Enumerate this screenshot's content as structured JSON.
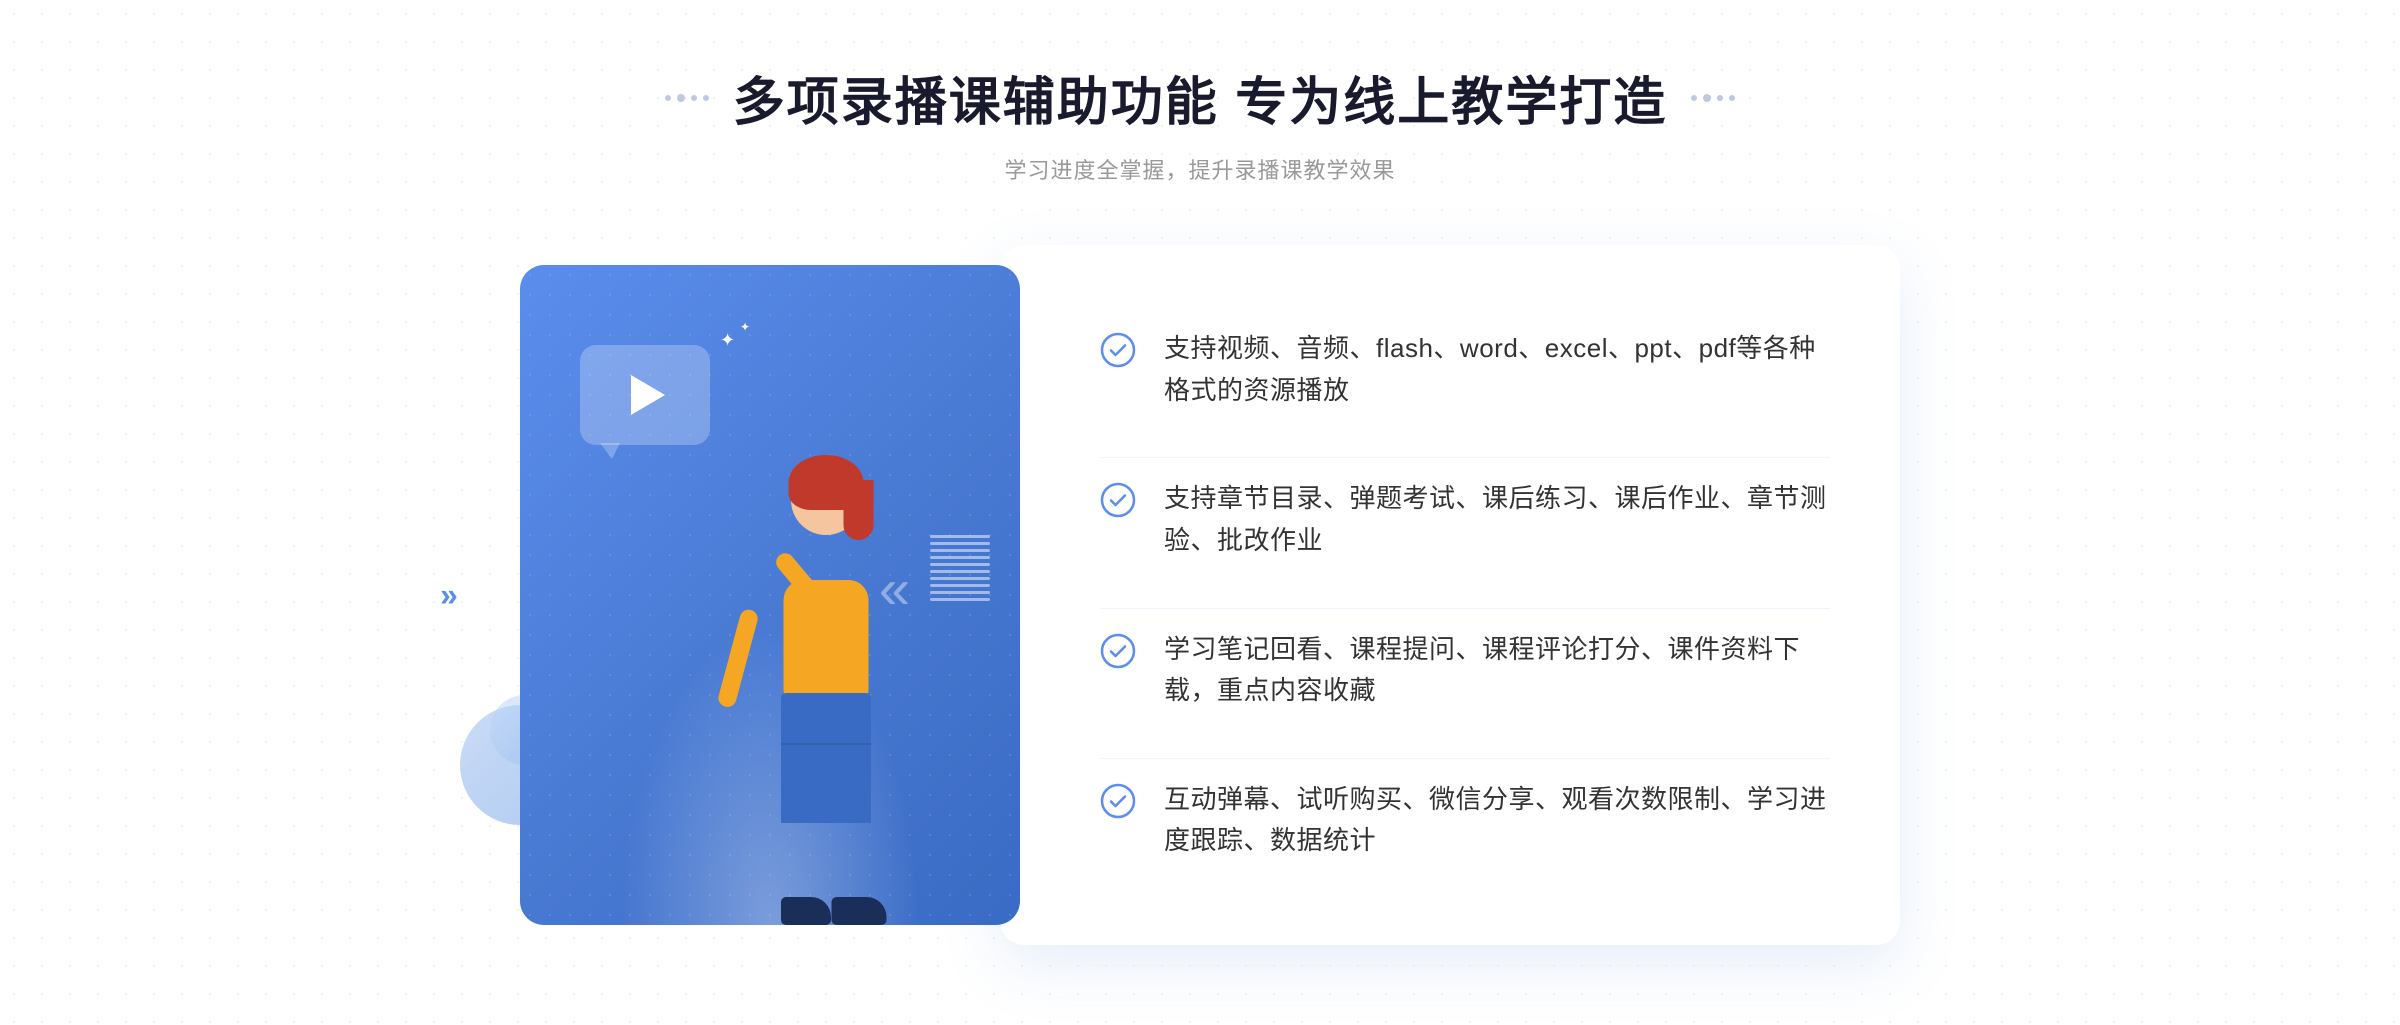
{
  "header": {
    "title": "多项录播课辅助功能 专为线上教学打造",
    "subtitle": "学习进度全掌握，提升录播课教学效果",
    "decorator_left": "⁝⁝",
    "decorator_right": "⁝⁝"
  },
  "features": [
    {
      "id": 1,
      "text": "支持视频、音频、flash、word、excel、ppt、pdf等各种格式的资源播放"
    },
    {
      "id": 2,
      "text": "支持章节目录、弹题考试、课后练习、课后作业、章节测验、批改作业"
    },
    {
      "id": 3,
      "text": "学习笔记回看、课程提问、课程评论打分、课件资料下载，重点内容收藏"
    },
    {
      "id": 4,
      "text": "互动弹幕、试听购买、微信分享、观看次数限制、学习进度跟踪、数据统计"
    }
  ],
  "colors": {
    "primary_blue": "#5b8dee",
    "dark_blue": "#3a6bc4",
    "text_dark": "#1a1a2e",
    "text_gray": "#999999",
    "text_body": "#333333"
  }
}
